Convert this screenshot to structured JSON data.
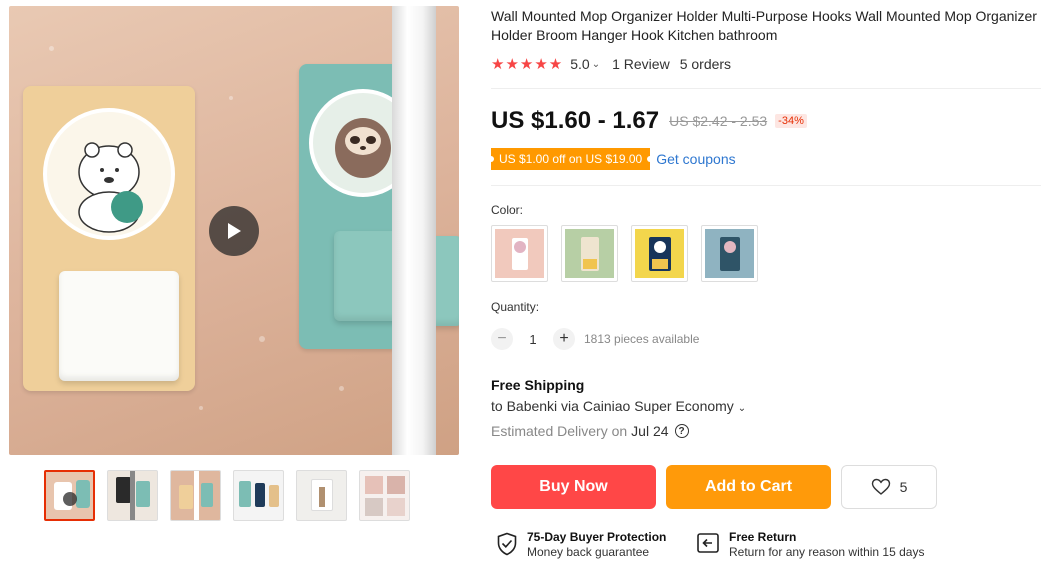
{
  "product": {
    "title": "Wall Mounted Mop Organizer Holder Multi-Purpose Hooks Wall Mounted Mop Organizer Holder Broom Hanger Hook Kitchen bathroom",
    "rating": "5.0",
    "reviews": "1 Review",
    "orders": "5 orders",
    "price": "US $1.60 - 1.67",
    "original_price": "US $2.42 - 2.53",
    "discount": "-34%",
    "coupon": "US $1.00 off on US $19.00",
    "get_coupons": "Get coupons",
    "color_label": "Color:",
    "colors": [
      "pink",
      "green",
      "yellow",
      "blue"
    ],
    "quantity_label": "Quantity:",
    "quantity": "1",
    "available": "1813 pieces available",
    "shipping_title": "Free Shipping",
    "shipping_to": "to Babenki via Cainiao Super Economy",
    "estimated_label": "Estimated Delivery on",
    "estimated_date": "Jul 24",
    "buy_now": "Buy Now",
    "add_to_cart": "Add to Cart",
    "wishlist_count": "5",
    "protection_title": "75-Day Buyer Protection",
    "protection_sub": "Money back guarantee",
    "return_title": "Free Return",
    "return_sub": "Return for any reason within 15 days"
  },
  "colors": {
    "accent_red": "#ff4747",
    "accent_orange": "#ff9a0a",
    "link_blue": "#2e77d0",
    "star": "#f74545"
  }
}
